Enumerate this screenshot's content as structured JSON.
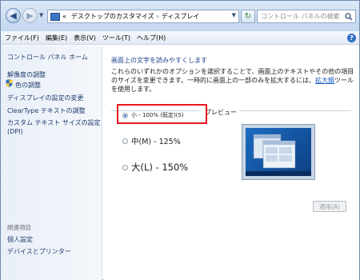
{
  "window": {
    "breadcrumb_root": "«",
    "breadcrumb_parent": "デスクトップのカスタマイズ",
    "breadcrumb_sep": "›",
    "breadcrumb_current": "ディスプレイ",
    "search_placeholder": "コントロール パネルの検索"
  },
  "menubar": {
    "items": [
      "ファイル(F)",
      "編集(E)",
      "表示(V)",
      "ツール(T)",
      "ヘルプ(H)"
    ]
  },
  "sidebar": {
    "home": "コントロール パネル ホーム",
    "links": [
      "解像度の調整",
      "色の調整",
      "ディスプレイの設定の変更",
      "ClearType テキストの調整",
      "カスタム テキスト サイズの設定 (DPI)"
    ],
    "related_header": "関連項目",
    "related": [
      "個人設定",
      "デバイスとプリンター"
    ]
  },
  "main": {
    "heading": "画面上の文字を読みやすくします",
    "desc_part1": "これらのいずれかのオプションを選択することで、画面上のテキストやその他の項目のサイズを変更できます。一時的に画面上の一部のみを拡大するには、",
    "desc_link": "拡大鏡",
    "desc_part2": "ツールを使用します。",
    "options": [
      {
        "label": "小 - 100% (既定)(S)",
        "selected": true
      },
      {
        "label": "中(M) - 125%",
        "selected": false
      },
      {
        "label": "大(L) - 150%",
        "selected": false
      }
    ],
    "preview_label": "プレビュー",
    "apply_label": "適用(A)"
  },
  "colors": {
    "highlight": "#e8171d",
    "link": "#1a5bc4",
    "heading": "#1f3f8c"
  }
}
